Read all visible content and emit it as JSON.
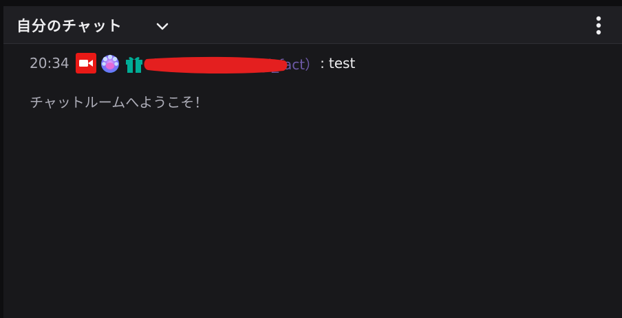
{
  "header": {
    "title": "自分のチャット",
    "dropdown_icon": "chevron-down-icon",
    "menu_icon": "vertical-dots-icon"
  },
  "chat": {
    "messages": [
      {
        "timestamp": "20:34",
        "badges": [
          "broadcaster-badge",
          "paw-badge",
          "gift-badge"
        ],
        "username": "ゆうなぎ（yuunagi_fact）",
        "username_redacted": true,
        "separator": ":",
        "text": "test"
      }
    ],
    "welcome_text": "チャットルームへようこそ！"
  },
  "colors": {
    "background": "#18181b",
    "header_background": "#1f1f23",
    "username": "#6e5aa8",
    "broadcaster_badge": "#e91916",
    "gift_badge": "#00ad96",
    "redaction": "#e41f1f"
  }
}
